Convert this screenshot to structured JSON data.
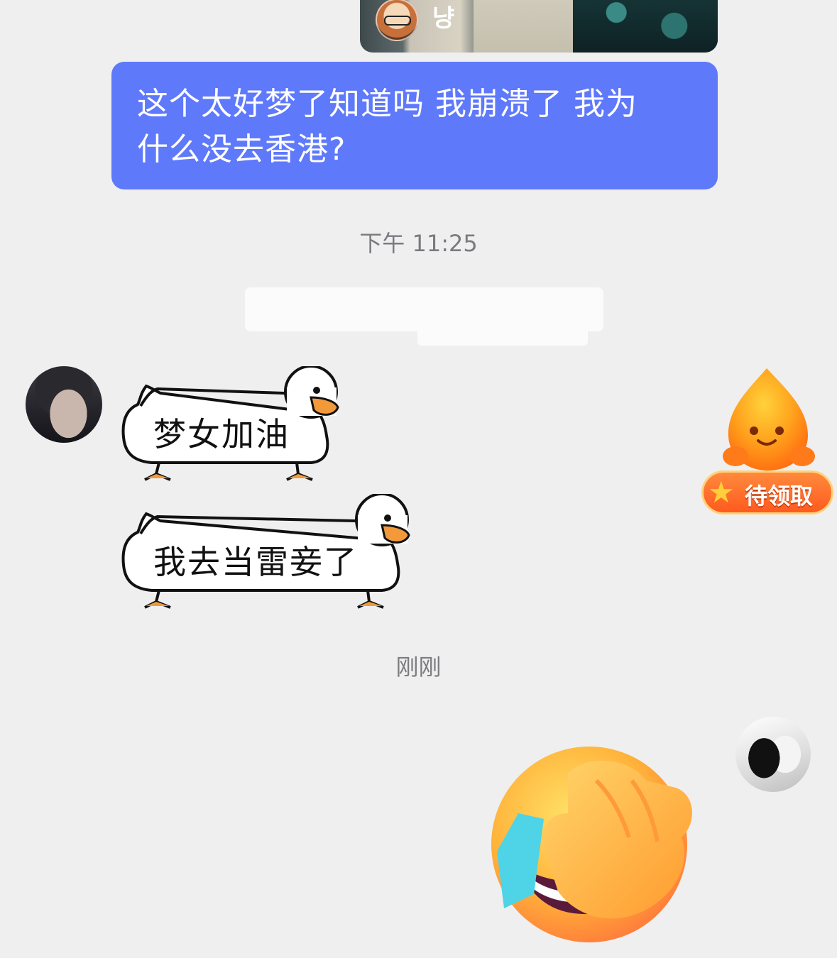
{
  "shared_card": {
    "title_text": "냥"
  },
  "messages": {
    "outgoing_text_line1": "这个太好梦了知道吗 我崩溃了 我为",
    "outgoing_text_line2": "什么没去香港?",
    "timestamp_1": "下午 11:25",
    "duck_sticker_1": "梦女加油",
    "duck_sticker_2": "我去当雷妾了",
    "timestamp_2": "刚刚"
  },
  "reward_widget": {
    "badge_label": "待领取"
  },
  "colors": {
    "background": "#efeff0",
    "outgoing_bubble": "#5f79fb",
    "timestamp_text": "#7b7b7f",
    "reward_orange": "#ff6a24"
  },
  "icons": {
    "reward_mascot": "orange-droplet-mascot-icon",
    "reward_star": "star-icon",
    "emoji": "face-palm-laughing-emoji-icon"
  }
}
